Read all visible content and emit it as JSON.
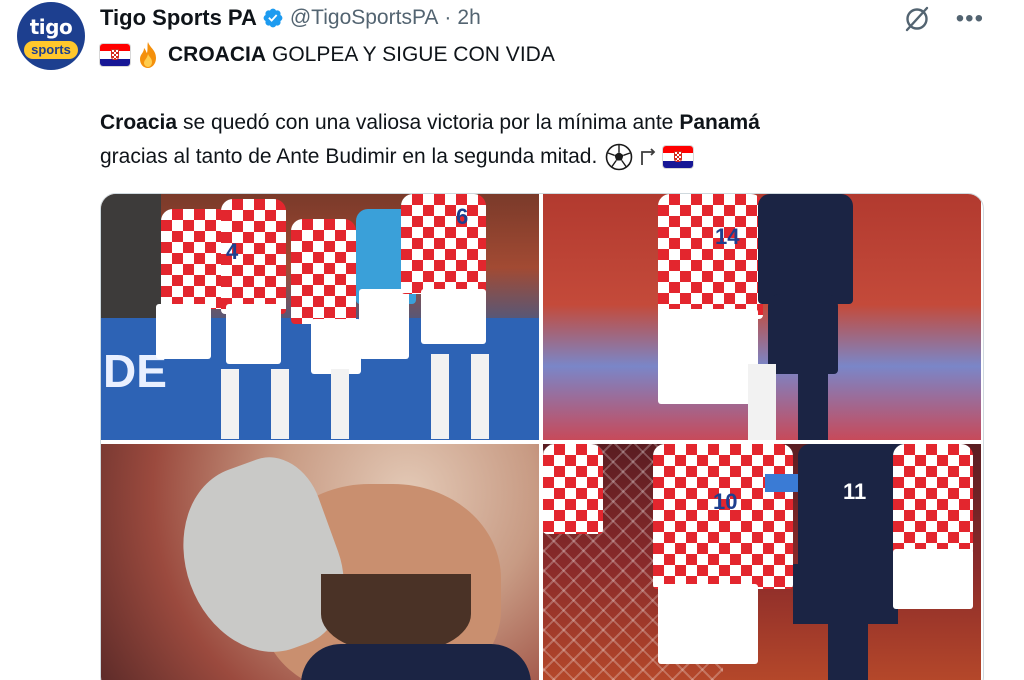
{
  "account": {
    "avatar_top": "tigo",
    "avatar_bottom": "sports",
    "display_name": "Tigo Sports PA",
    "handle": "@TigoSportsPA",
    "separator": "·",
    "time": "2h"
  },
  "header_icons": [
    "verified-badge-icon",
    "grok-icon",
    "more-icon"
  ],
  "tweet": {
    "headline_bold": "CROACIA",
    "headline_rest": "GOLPEA Y SIGUE CON VIDA",
    "body_bold_1": "Croacia",
    "body_text_1": "se quedó con una valiosa victoria por la mínima ante",
    "body_bold_2": "Panamá",
    "body_text_2": "gracias al tanto de Ante Budimir en la segunda mitad."
  },
  "emoji": [
    "croatia-flag",
    "fire",
    "soccer-ball",
    "arrow",
    "croatia-flag"
  ],
  "media": {
    "photos": [
      {
        "label": "celebration",
        "text": "DE",
        "numbers": [
          "4",
          "6"
        ]
      },
      {
        "label": "duel",
        "numbers": [
          "14"
        ]
      },
      {
        "label": "player-closeup"
      },
      {
        "label": "action",
        "numbers": [
          "10",
          "11"
        ]
      }
    ]
  },
  "colors": {
    "text": "#0f1419",
    "secondary": "#536471",
    "verified": "#1d9bf0",
    "border": "#cfd9de",
    "croatia_red": "#e3262e",
    "panama_navy": "#1b2444"
  }
}
